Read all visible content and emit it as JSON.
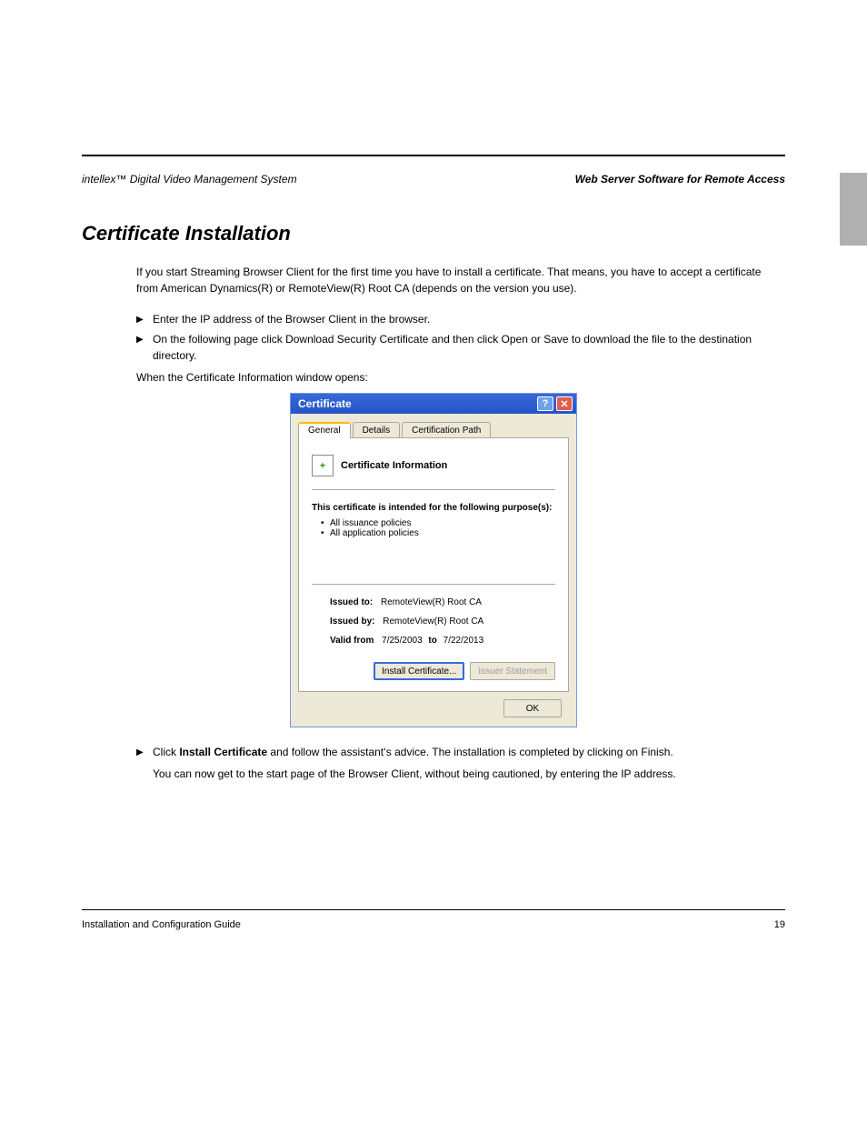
{
  "header": {
    "left": "intellex™ Digital Video Management System",
    "right": "Web Server Software for Remote Access"
  },
  "section_title": "Certificate Installation",
  "paragraphs": {
    "intro": "If you start Streaming Browser Client for the first time you have to install a certificate. That means, you have to accept a certificate from American Dynamics(R) or RemoteView(R) Root CA (depends on the version you use).",
    "after_figure_intro": "When the Certificate Information window opens:"
  },
  "bullets": {
    "b1": "Enter the IP address of the Browser Client in the browser.",
    "b2": "On the following page click Download Security Certificate and then click Open or Save to download the file to the destination directory.",
    "b3_prefix": "Click ",
    "b3_action": "Install Certificate",
    "b3_suffix": " and follow the assistant‘s advice. The installation is completed by clicking on Finish.",
    "b3_extra": "You can now get to the start page of the Browser Client, without being cautioned, by entering the IP address."
  },
  "dialog": {
    "title": "Certificate",
    "tabs": {
      "general": "General",
      "details": "Details",
      "certpath": "Certification Path"
    },
    "info_heading": "Certificate Information",
    "purpose_label": "This certificate is intended for the following purpose(s):",
    "purposes": [
      "All issuance policies",
      "All application policies"
    ],
    "issued_to_label": "Issued to:",
    "issued_to_value": "RemoteView(R) Root CA",
    "issued_by_label": "Issued by:",
    "issued_by_value": "RemoteView(R) Root CA",
    "valid_label_from": "Valid from",
    "valid_from": "7/25/2003",
    "valid_label_to": "to",
    "valid_to": "7/22/2013",
    "install_btn": "Install Certificate...",
    "issuer_btn": "Issuer Statement",
    "ok_btn": "OK"
  },
  "footer": {
    "left": "Installation and Configuration Guide",
    "right": "19"
  }
}
